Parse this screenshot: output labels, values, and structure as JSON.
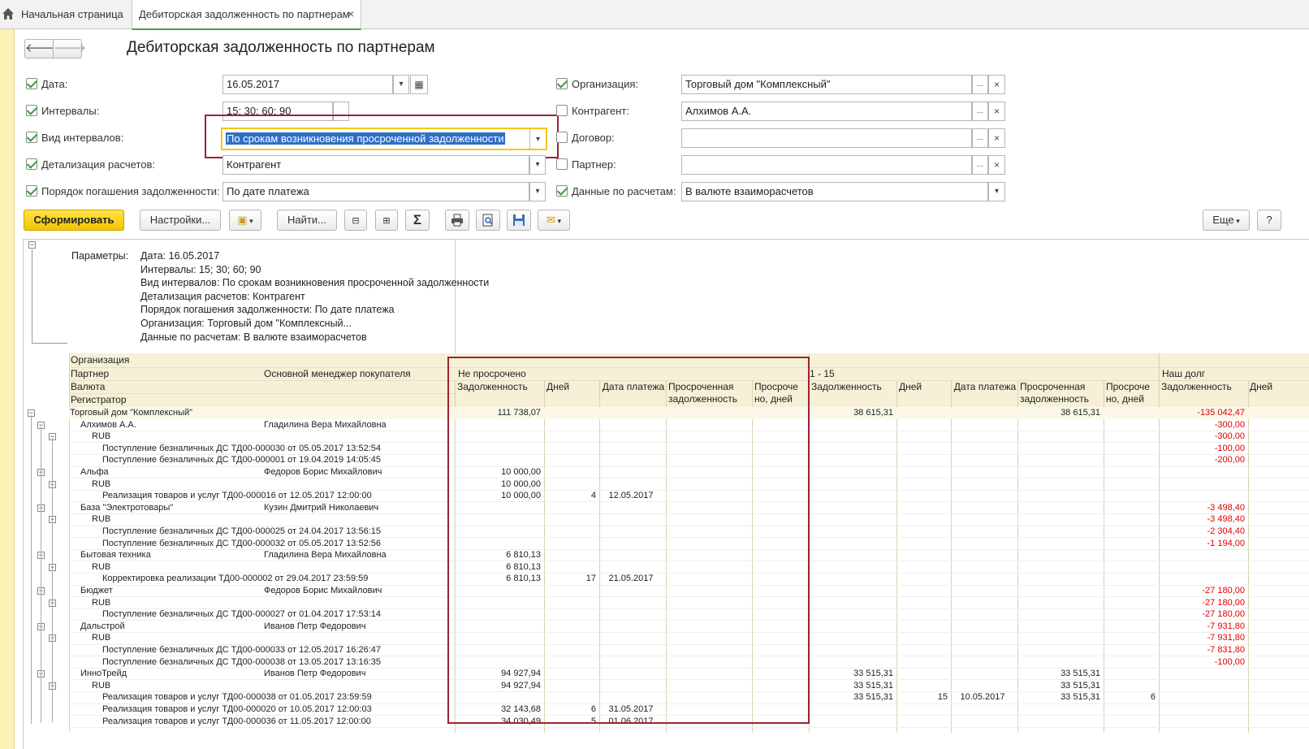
{
  "tabs": {
    "home": "Начальная страница",
    "report": "Дебиторская задолженность по партнерам"
  },
  "page_title": "Дебиторская задолженность по партнерам",
  "form": {
    "date": {
      "label": "Дата:",
      "value": "16.05.2017",
      "checked": true
    },
    "intervals": {
      "label": "Интервалы:",
      "value": "15; 30; 60; 90",
      "checked": true
    },
    "interval_kind": {
      "label": "Вид интервалов:",
      "value": "По срокам возникновения просроченной задолженности",
      "checked": true
    },
    "detail": {
      "label": "Детализация расчетов:",
      "value": "Контрагент",
      "checked": true
    },
    "repay_order": {
      "label": "Порядок погашения задолженности:",
      "value": "По дате платежа",
      "checked": true
    },
    "organization": {
      "label": "Организация:",
      "value": "Торговый дом \"Комплексный\"",
      "checked": true
    },
    "counterparty": {
      "label": "Контрагент:",
      "value": "Алхимов А.А.",
      "checked": false
    },
    "contract": {
      "label": "Договор:",
      "value": "",
      "checked": false
    },
    "partner": {
      "label": "Партнер:",
      "value": "",
      "checked": false
    },
    "settlement_data": {
      "label": "Данные по расчетам:",
      "value": "В валюте взаиморасчетов",
      "checked": true
    }
  },
  "toolbar": {
    "generate": "Сформировать",
    "settings": "Настройки...",
    "find": "Найти...",
    "more": "Еще",
    "help": "?",
    "sigma": "Σ"
  },
  "params": {
    "label": "Параметры:",
    "lines": [
      "Дата: 16.05.2017",
      "Интервалы: 15; 30; 60; 90",
      "Вид интервалов: По срокам возникновения просроченной задолженности",
      "Детализация расчетов: Контрагент",
      "Порядок погашения задолженности: По дате платежа",
      "Организация: Торговый дом \"Комплексный...",
      "Данные по расчетам: В валюте взаиморасчетов"
    ]
  },
  "table_header": {
    "org": "Организация",
    "partner": "Партнер",
    "manager": "Основной менеджер покупателя",
    "currency": "Валюта",
    "registrar": "Регистратор",
    "not_overdue": "Не просрочено",
    "range_1_15": "1 - 15",
    "our_debt": "Наш долг",
    "debt": "Задолженность",
    "days": "Дней",
    "pay_date": "Дата платежа",
    "overdue_debt": "Просроченная задолженность",
    "overdue_days": "Просроче но, дней"
  },
  "rows": [
    {
      "level": 0,
      "name": "Торговый дом \"Комплексный\"",
      "manager": "",
      "a1": "111 738,07",
      "a2": "",
      "a3": "",
      "b1": "38 615,31",
      "b2": "",
      "b3": "",
      "b4": "38 615,31",
      "b5": "",
      "c1": "-135 042,47"
    },
    {
      "level": 1,
      "name": "Алхимов А.А.",
      "manager": "Гладилина Вера Михайловна",
      "a1": "",
      "a2": "",
      "a3": "",
      "b1": "",
      "b2": "",
      "b3": "",
      "b4": "",
      "b5": "",
      "c1": "-300,00"
    },
    {
      "level": 2,
      "name": "RUB",
      "manager": "",
      "a1": "",
      "a2": "",
      "a3": "",
      "b1": "",
      "b2": "",
      "b3": "",
      "b4": "",
      "b5": "",
      "c1": "-300,00"
    },
    {
      "level": 3,
      "name": "Поступление безналичных ДС ТД00-000030 от 05.05.2017 13:52:54",
      "manager": "",
      "a1": "",
      "a2": "",
      "a3": "",
      "b1": "",
      "b2": "",
      "b3": "",
      "b4": "",
      "b5": "",
      "c1": "-100,00"
    },
    {
      "level": 3,
      "name": "Поступление безналичных ДС ТД00-000001 от 19.04.2019 14:05:45",
      "manager": "",
      "a1": "",
      "a2": "",
      "a3": "",
      "b1": "",
      "b2": "",
      "b3": "",
      "b4": "",
      "b5": "",
      "c1": "-200,00"
    },
    {
      "level": 1,
      "name": "Альфа",
      "manager": "Федоров Борис Михайлович",
      "a1": "10 000,00",
      "a2": "",
      "a3": "",
      "b1": "",
      "b2": "",
      "b3": "",
      "b4": "",
      "b5": "",
      "c1": ""
    },
    {
      "level": 2,
      "name": "RUB",
      "manager": "",
      "a1": "10 000,00",
      "a2": "",
      "a3": "",
      "b1": "",
      "b2": "",
      "b3": "",
      "b4": "",
      "b5": "",
      "c1": ""
    },
    {
      "level": 3,
      "name": "Реализация товаров и услуг ТД00-000016 от 12.05.2017 12:00:00",
      "manager": "",
      "a1": "10 000,00",
      "a2": "4",
      "a3": "12.05.2017",
      "b1": "",
      "b2": "",
      "b3": "",
      "b4": "",
      "b5": "",
      "c1": ""
    },
    {
      "level": 1,
      "name": "База \"Электротовары\"",
      "manager": "Кузин Дмитрий Николаевич",
      "a1": "",
      "a2": "",
      "a3": "",
      "b1": "",
      "b2": "",
      "b3": "",
      "b4": "",
      "b5": "",
      "c1": "-3 498,40"
    },
    {
      "level": 2,
      "name": "RUB",
      "manager": "",
      "a1": "",
      "a2": "",
      "a3": "",
      "b1": "",
      "b2": "",
      "b3": "",
      "b4": "",
      "b5": "",
      "c1": "-3 498,40"
    },
    {
      "level": 3,
      "name": "Поступление безналичных ДС ТД00-000025 от 24.04.2017 13:56:15",
      "manager": "",
      "a1": "",
      "a2": "",
      "a3": "",
      "b1": "",
      "b2": "",
      "b3": "",
      "b4": "",
      "b5": "",
      "c1": "-2 304,40"
    },
    {
      "level": 3,
      "name": "Поступление безналичных ДС ТД00-000032 от 05.05.2017 13:52:56",
      "manager": "",
      "a1": "",
      "a2": "",
      "a3": "",
      "b1": "",
      "b2": "",
      "b3": "",
      "b4": "",
      "b5": "",
      "c1": "-1 194,00"
    },
    {
      "level": 1,
      "name": "Бытовая техника",
      "manager": "Гладилина Вера Михайловна",
      "a1": "6 810,13",
      "a2": "",
      "a3": "",
      "b1": "",
      "b2": "",
      "b3": "",
      "b4": "",
      "b5": "",
      "c1": ""
    },
    {
      "level": 2,
      "name": "RUB",
      "manager": "",
      "a1": "6 810,13",
      "a2": "",
      "a3": "",
      "b1": "",
      "b2": "",
      "b3": "",
      "b4": "",
      "b5": "",
      "c1": ""
    },
    {
      "level": 3,
      "name": "Корректировка реализации ТД00-000002 от 29.04.2017 23:59:59",
      "manager": "",
      "a1": "6 810,13",
      "a2": "17",
      "a3": "21.05.2017",
      "b1": "",
      "b2": "",
      "b3": "",
      "b4": "",
      "b5": "",
      "c1": ""
    },
    {
      "level": 1,
      "name": "Бюджет",
      "manager": "Федоров Борис Михайлович",
      "a1": "",
      "a2": "",
      "a3": "",
      "b1": "",
      "b2": "",
      "b3": "",
      "b4": "",
      "b5": "",
      "c1": "-27 180,00"
    },
    {
      "level": 2,
      "name": "RUB",
      "manager": "",
      "a1": "",
      "a2": "",
      "a3": "",
      "b1": "",
      "b2": "",
      "b3": "",
      "b4": "",
      "b5": "",
      "c1": "-27 180,00"
    },
    {
      "level": 3,
      "name": "Поступление безналичных ДС ТД00-000027 от 01.04.2017 17:53:14",
      "manager": "",
      "a1": "",
      "a2": "",
      "a3": "",
      "b1": "",
      "b2": "",
      "b3": "",
      "b4": "",
      "b5": "",
      "c1": "-27 180,00"
    },
    {
      "level": 1,
      "name": "Дальстрой",
      "manager": "Иванов Петр Федорович",
      "a1": "",
      "a2": "",
      "a3": "",
      "b1": "",
      "b2": "",
      "b3": "",
      "b4": "",
      "b5": "",
      "c1": "-7 931,80"
    },
    {
      "level": 2,
      "name": "RUB",
      "manager": "",
      "a1": "",
      "a2": "",
      "a3": "",
      "b1": "",
      "b2": "",
      "b3": "",
      "b4": "",
      "b5": "",
      "c1": "-7 931,80"
    },
    {
      "level": 3,
      "name": "Поступление безналичных ДС ТД00-000033 от 12.05.2017 16:26:47",
      "manager": "",
      "a1": "",
      "a2": "",
      "a3": "",
      "b1": "",
      "b2": "",
      "b3": "",
      "b4": "",
      "b5": "",
      "c1": "-7 831,80"
    },
    {
      "level": 3,
      "name": "Поступление безналичных ДС ТД00-000038 от 13.05.2017 13:16:35",
      "manager": "",
      "a1": "",
      "a2": "",
      "a3": "",
      "b1": "",
      "b2": "",
      "b3": "",
      "b4": "",
      "b5": "",
      "c1": "-100,00"
    },
    {
      "level": 1,
      "name": "ИнноТрейд",
      "manager": "Иванов Петр Федорович",
      "a1": "94 927,94",
      "a2": "",
      "a3": "",
      "b1": "33 515,31",
      "b2": "",
      "b3": "",
      "b4": "33 515,31",
      "b5": "",
      "c1": ""
    },
    {
      "level": 2,
      "name": "RUB",
      "manager": "",
      "a1": "94 927,94",
      "a2": "",
      "a3": "",
      "b1": "33 515,31",
      "b2": "",
      "b3": "",
      "b4": "33 515,31",
      "b5": "",
      "c1": ""
    },
    {
      "level": 3,
      "name": "Реализация товаров и услуг ТД00-000038 от 01.05.2017 23:59:59",
      "manager": "",
      "a1": "",
      "a2": "",
      "a3": "",
      "b1": "33 515,31",
      "b2": "15",
      "b3": "10.05.2017",
      "b4": "33 515,31",
      "b5": "6",
      "c1": ""
    },
    {
      "level": 3,
      "name": "Реализация товаров и услуг ТД00-000020 от 10.05.2017 12:00:03",
      "manager": "",
      "a1": "32 143,68",
      "a2": "6",
      "a3": "31.05.2017",
      "b1": "",
      "b2": "",
      "b3": "",
      "b4": "",
      "b5": "",
      "c1": ""
    },
    {
      "level": 3,
      "name": "Реализация товаров и услуг ТД00-000036 от 11.05.2017 12:00:00",
      "manager": "",
      "a1": "34 030,49",
      "a2": "5",
      "a3": "01.06.2017",
      "b1": "",
      "b2": "",
      "b3": "",
      "b4": "",
      "b5": "",
      "c1": ""
    }
  ]
}
